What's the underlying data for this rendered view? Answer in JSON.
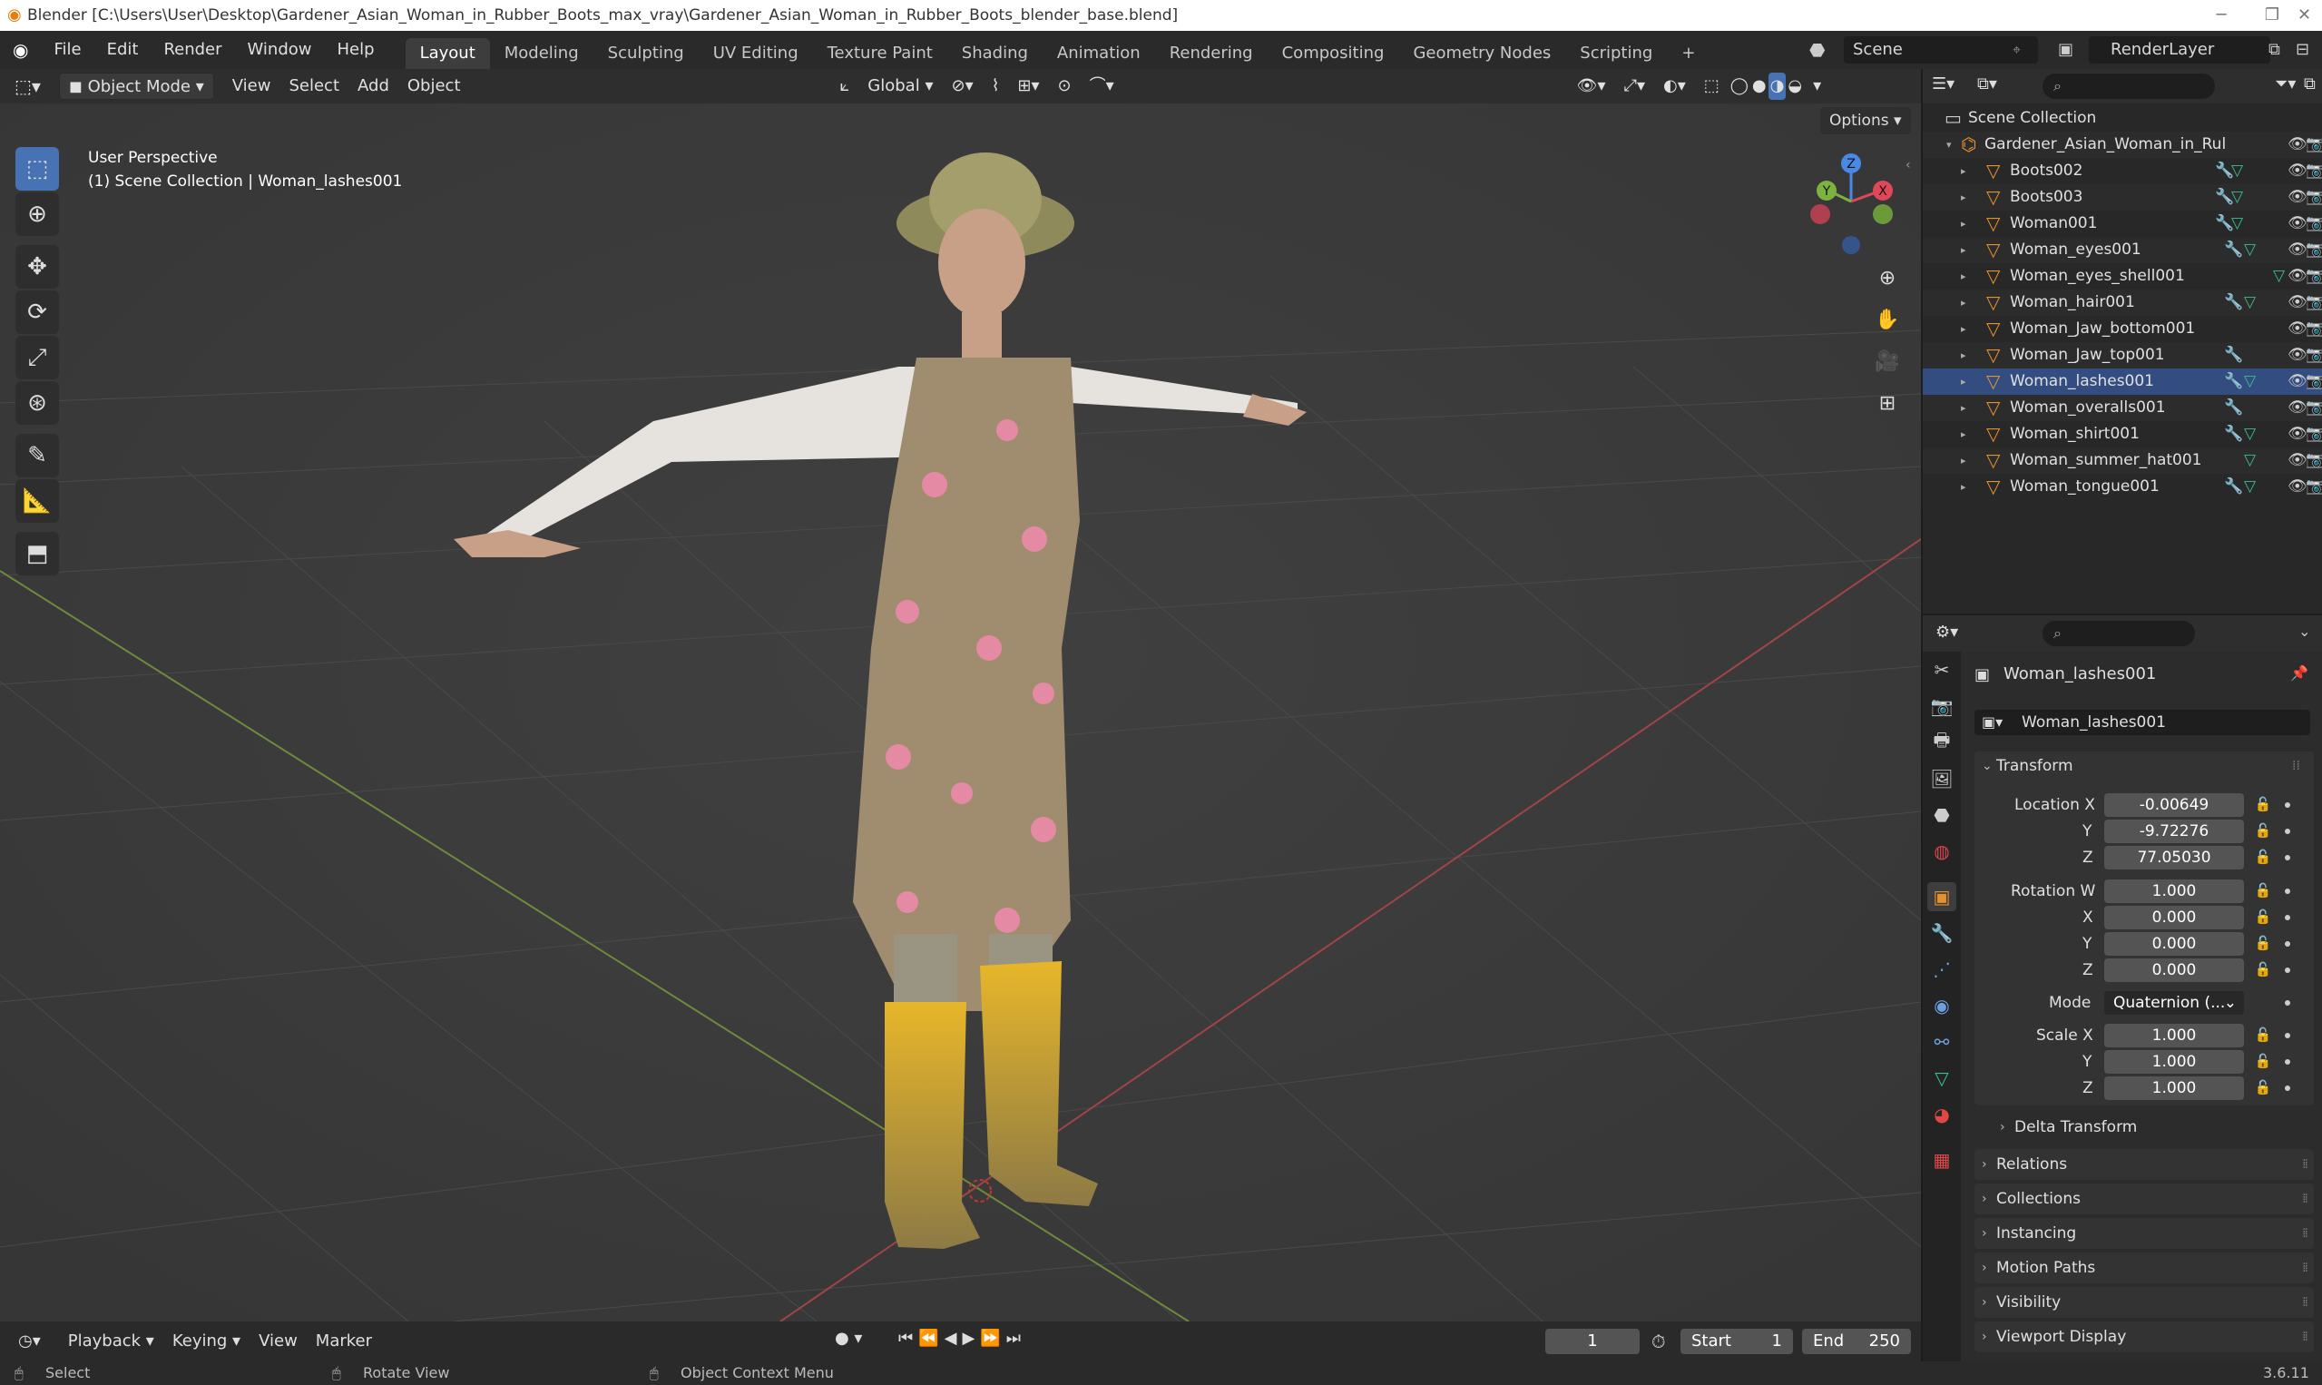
{
  "window": {
    "title": "Blender [C:\\Users\\User\\Desktop\\Gardener_Asian_Woman_in_Rubber_Boots_max_vray\\Gardener_Asian_Woman_in_Rubber_Boots_blender_base.blend]",
    "minimize": "─",
    "maximize": "❐",
    "close": "✕"
  },
  "menu": {
    "file": "File",
    "edit": "Edit",
    "render": "Render",
    "window": "Window",
    "help": "Help"
  },
  "workspaces": [
    "Layout",
    "Modeling",
    "Sculpting",
    "UV Editing",
    "Texture Paint",
    "Shading",
    "Animation",
    "Rendering",
    "Compositing",
    "Geometry Nodes",
    "Scripting",
    "+"
  ],
  "scene": {
    "name": "Scene",
    "view_layer": "RenderLayer"
  },
  "viewport_header": {
    "mode": "Object Mode",
    "view": "View",
    "select": "Select",
    "add": "Add",
    "object": "Object",
    "orientation": "Global",
    "options": "Options"
  },
  "viewport": {
    "perspective": "User Perspective",
    "context": "(1) Scene Collection | Woman_lashes001",
    "axis_x": "X",
    "axis_y": "Y",
    "axis_z": "Z"
  },
  "timeline": {
    "playback": "Playback",
    "keying": "Keying",
    "view": "View",
    "marker": "Marker",
    "current_frame": "1",
    "start_label": "Start",
    "start": "1",
    "end_label": "End",
    "end": "250"
  },
  "statusbar": {
    "select": "Select",
    "rotate": "Rotate View",
    "context_menu": "Object Context Menu",
    "version": "3.6.11"
  },
  "outliner": {
    "root": "Scene Collection",
    "collection": "Gardener_Asian_Woman_in_Rul",
    "objects": [
      {
        "name": "Boots002"
      },
      {
        "name": "Boots003"
      },
      {
        "name": "Woman001"
      },
      {
        "name": "Woman_eyes001"
      },
      {
        "name": "Woman_eyes_shell001"
      },
      {
        "name": "Woman_hair001"
      },
      {
        "name": "Woman_Jaw_bottom001"
      },
      {
        "name": "Woman_Jaw_top001"
      },
      {
        "name": "Woman_lashes001"
      },
      {
        "name": "Woman_overalls001"
      },
      {
        "name": "Woman_shirt001"
      },
      {
        "name": "Woman_summer_hat001"
      },
      {
        "name": "Woman_tongue001"
      }
    ]
  },
  "properties": {
    "object_name": "Woman_lashes001",
    "datablock": "Woman_lashes001",
    "transform": {
      "title": "Transform",
      "location_label": "Location X",
      "loc_y_label": "Y",
      "loc_z_label": "Z",
      "location": [
        "-0.00649",
        "-9.72276",
        "77.05030"
      ],
      "rotation_label": "Rotation W",
      "rot_x_label": "X",
      "rot_y_label": "Y",
      "rot_z_label": "Z",
      "rotation": [
        "1.000",
        "0.000",
        "0.000",
        "0.000"
      ],
      "mode_label": "Mode",
      "mode": "Quaternion (...",
      "scale_label": "Scale X",
      "scale_y_label": "Y",
      "scale_z_label": "Z",
      "scale": [
        "1.000",
        "1.000",
        "1.000"
      ],
      "delta": "Delta Transform"
    },
    "panels": [
      "Relations",
      "Collections",
      "Instancing",
      "Motion Paths",
      "Visibility",
      "Viewport Display"
    ]
  },
  "colors": {
    "accent": "#4772b3",
    "object_orange": "#e5912f",
    "mesh_green": "#35c28f",
    "modifier_blue": "#6e9fe0"
  }
}
